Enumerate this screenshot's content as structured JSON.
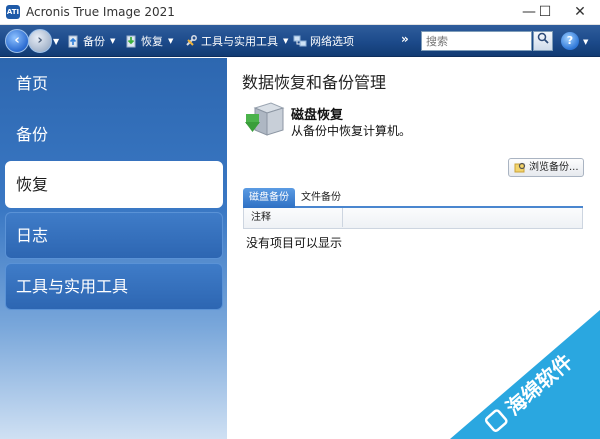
{
  "window": {
    "title": "Acronis True Image 2021",
    "minimize": "—",
    "maximize": "☐",
    "close": "✕"
  },
  "toolbar": {
    "back_glyph": "‹",
    "forward_glyph": "›",
    "backup_label": "备份",
    "recovery_label": "恢复",
    "tools_label": "工具与实用工具",
    "network_label": "网络选项",
    "overflow": "»",
    "search_placeholder": "搜索",
    "help_glyph": "?"
  },
  "sidebar": {
    "items": [
      {
        "label": "首页"
      },
      {
        "label": "备份"
      },
      {
        "label": "恢复"
      },
      {
        "label": "日志"
      },
      {
        "label": "工具与实用工具"
      }
    ],
    "active_index": 2
  },
  "main": {
    "page_title": "数据恢复和备份管理",
    "section_title": "磁盘恢复",
    "section_desc": "从备份中恢复计算机。",
    "browse_label": "浏览备份...",
    "tabs": [
      {
        "label": "磁盘备份"
      },
      {
        "label": "文件备份"
      }
    ],
    "column_header": "注释",
    "empty_message": "没有项目可以显示"
  },
  "watermark": {
    "text": "海绵软件"
  },
  "colors": {
    "toolbar": "#1c4a8a",
    "sidebar": "#2d67b0",
    "accent": "#4a86cf",
    "watermark": "#2aa7e0"
  }
}
